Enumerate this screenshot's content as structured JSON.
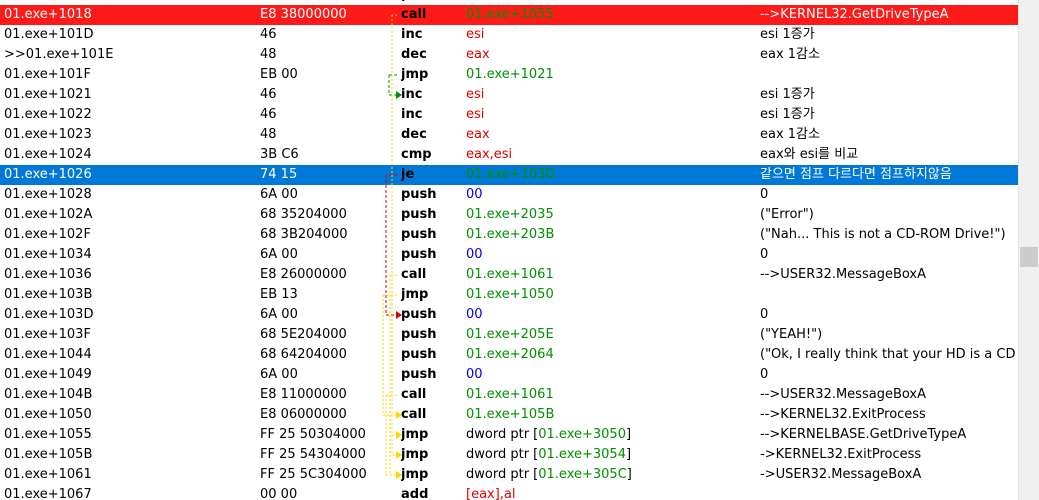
{
  "partial_top": {
    "mnemonic": "push"
  },
  "rows": [
    {
      "addr": "01.exe+1018",
      "bytes": "E8 38000000",
      "mn": "call",
      "ops": [
        {
          "t": "addr",
          "v": "01.exe+1055"
        }
      ],
      "comment": "-->KERNEL32.GetDriveTypeA",
      "hl": "red"
    },
    {
      "addr": "01.exe+101D",
      "bytes": "46",
      "mn": "inc",
      "ops": [
        {
          "t": "reg",
          "v": "esi"
        }
      ],
      "comment": "esi 1증가",
      "hl": ""
    },
    {
      "addr": ">>01.exe+101E",
      "bytes": "48",
      "mn": "dec",
      "ops": [
        {
          "t": "reg",
          "v": "eax"
        }
      ],
      "comment": "eax 1감소",
      "hl": ""
    },
    {
      "addr": "01.exe+101F",
      "bytes": "EB 00",
      "mn": "jmp",
      "ops": [
        {
          "t": "addr",
          "v": "01.exe+1021"
        }
      ],
      "comment": "",
      "hl": ""
    },
    {
      "addr": "01.exe+1021",
      "bytes": "46",
      "mn": "inc",
      "ops": [
        {
          "t": "reg",
          "v": "esi"
        }
      ],
      "comment": "esi 1증가",
      "hl": ""
    },
    {
      "addr": "01.exe+1022",
      "bytes": "46",
      "mn": "inc",
      "ops": [
        {
          "t": "reg",
          "v": "esi"
        }
      ],
      "comment": "esi 1증가",
      "hl": ""
    },
    {
      "addr": "01.exe+1023",
      "bytes": "48",
      "mn": "dec",
      "ops": [
        {
          "t": "reg",
          "v": "eax"
        }
      ],
      "comment": "eax 1감소",
      "hl": ""
    },
    {
      "addr": "01.exe+1024",
      "bytes": "3B C6",
      "mn": "cmp",
      "ops": [
        {
          "t": "reg",
          "v": "eax,esi"
        }
      ],
      "comment": "eax와 esi를 비교",
      "hl": ""
    },
    {
      "addr": "01.exe+1026",
      "bytes": "74 15",
      "mn": "je",
      "ops": [
        {
          "t": "addr",
          "v": "01.exe+103D"
        }
      ],
      "comment": "같으면 점프 다르다면 점프하지않음",
      "hl": "blue"
    },
    {
      "addr": "01.exe+1028",
      "bytes": "6A 00",
      "mn": "push",
      "ops": [
        {
          "t": "imm",
          "v": "00"
        }
      ],
      "comment": "0",
      "hl": ""
    },
    {
      "addr": "01.exe+102A",
      "bytes": "68 35204000",
      "mn": "push",
      "ops": [
        {
          "t": "addr",
          "v": "01.exe+2035"
        }
      ],
      "comment": "(\"Error\")",
      "hl": ""
    },
    {
      "addr": "01.exe+102F",
      "bytes": "68 3B204000",
      "mn": "push",
      "ops": [
        {
          "t": "addr",
          "v": "01.exe+203B"
        }
      ],
      "comment": "(\"Nah... This is not a CD-ROM Drive!\")",
      "hl": ""
    },
    {
      "addr": "01.exe+1034",
      "bytes": "6A 00",
      "mn": "push",
      "ops": [
        {
          "t": "imm",
          "v": "00"
        }
      ],
      "comment": "0",
      "hl": ""
    },
    {
      "addr": "01.exe+1036",
      "bytes": "E8 26000000",
      "mn": "call",
      "ops": [
        {
          "t": "addr",
          "v": "01.exe+1061"
        }
      ],
      "comment": "-->USER32.MessageBoxA",
      "hl": ""
    },
    {
      "addr": "01.exe+103B",
      "bytes": "EB 13",
      "mn": "jmp",
      "ops": [
        {
          "t": "addr",
          "v": "01.exe+1050"
        }
      ],
      "comment": "",
      "hl": ""
    },
    {
      "addr": "01.exe+103D",
      "bytes": "6A 00",
      "mn": "push",
      "ops": [
        {
          "t": "imm",
          "v": "00"
        }
      ],
      "comment": "0",
      "hl": ""
    },
    {
      "addr": "01.exe+103F",
      "bytes": "68 5E204000",
      "mn": "push",
      "ops": [
        {
          "t": "addr",
          "v": "01.exe+205E"
        }
      ],
      "comment": "(\"YEAH!\")",
      "hl": ""
    },
    {
      "addr": "01.exe+1044",
      "bytes": "68 64204000",
      "mn": "push",
      "ops": [
        {
          "t": "addr",
          "v": "01.exe+2064"
        }
      ],
      "comment": "(\"Ok, I really think that your HD is a CD",
      "hl": ""
    },
    {
      "addr": "01.exe+1049",
      "bytes": "6A 00",
      "mn": "push",
      "ops": [
        {
          "t": "imm",
          "v": "00"
        }
      ],
      "comment": "0",
      "hl": ""
    },
    {
      "addr": "01.exe+104B",
      "bytes": "E8 11000000",
      "mn": "call",
      "ops": [
        {
          "t": "addr",
          "v": "01.exe+1061"
        }
      ],
      "comment": "-->USER32.MessageBoxA",
      "hl": ""
    },
    {
      "addr": "01.exe+1050",
      "bytes": "E8 06000000",
      "mn": "call",
      "ops": [
        {
          "t": "addr",
          "v": "01.exe+105B"
        }
      ],
      "comment": "-->KERNEL32.ExitProcess",
      "hl": ""
    },
    {
      "addr": "01.exe+1055",
      "bytes": "FF 25 50304000",
      "mn": "jmp",
      "ops": [
        {
          "t": "mem",
          "v": "dword ptr ["
        },
        {
          "t": "addr",
          "v": "01.exe+3050"
        },
        {
          "t": "mem",
          "v": "]"
        }
      ],
      "comment": "-->KERNELBASE.GetDriveTypeA",
      "hl": ""
    },
    {
      "addr": "01.exe+105B",
      "bytes": "FF 25 54304000",
      "mn": "jmp",
      "ops": [
        {
          "t": "mem",
          "v": "dword ptr ["
        },
        {
          "t": "addr",
          "v": "01.exe+3054"
        },
        {
          "t": "mem",
          "v": "]"
        }
      ],
      "comment": "->KERNEL32.ExitProcess",
      "hl": ""
    },
    {
      "addr": "01.exe+1061",
      "bytes": "FF 25 5C304000",
      "mn": "jmp",
      "ops": [
        {
          "t": "mem",
          "v": "dword ptr ["
        },
        {
          "t": "addr",
          "v": "01.exe+305C"
        },
        {
          "t": "mem",
          "v": "]"
        }
      ],
      "comment": "->USER32.MessageBoxA",
      "hl": ""
    },
    {
      "addr": "01.exe+1067",
      "bytes": "00 00",
      "mn": "add",
      "ops": [
        {
          "t": "reg",
          "v": "[eax],al"
        }
      ],
      "comment": "",
      "hl": ""
    }
  ],
  "colors": {
    "register": "#e00000",
    "address": "#009000",
    "immediate": "#0000ee",
    "highlight_red": "#ff1a1a",
    "highlight_blue": "#0078d7",
    "jump_taken": "#ffd700",
    "jump_not_taken": "#e00000",
    "jump_green": "#009000"
  }
}
